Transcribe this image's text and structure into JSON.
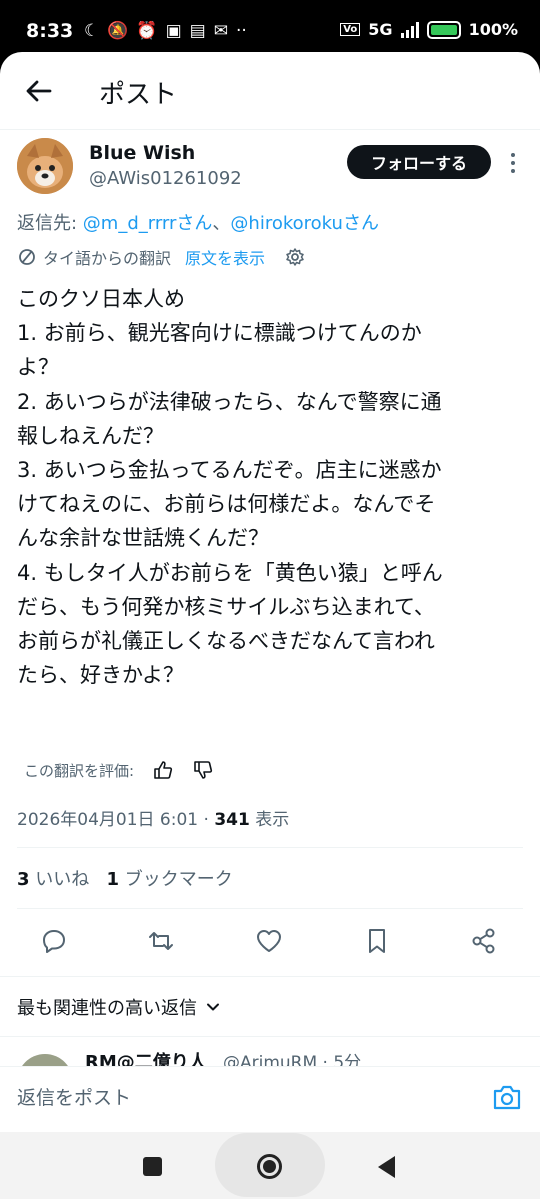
{
  "status_bar": {
    "time": "8:33",
    "network": "5G",
    "battery": "100%"
  },
  "header": {
    "title": "ポスト"
  },
  "post": {
    "author_name": "Blue Wish",
    "author_handle": "@AWis01261092",
    "follow_label": "フォローする",
    "reply_to_prefix": "返信先: ",
    "reply_to_user1": "@m_d_rrrrさん",
    "reply_to_sep": "、",
    "reply_to_user2": "@hirokorokuさん",
    "translated_from": "タイ語からの翻訳",
    "show_original": "原文を表示",
    "text_lines": [
      "このクソ日本人め",
      "1. お前ら、観光客向けに標識つけてんのか",
      "よ？",
      "2. あいつらが法律破ったら、なんで警察に通",
      "報しねえんだ？",
      "3. あいつら金払ってるんだぞ。店主に迷惑か",
      "けてねえのに、お前らは何様だよ。なんでそ",
      "んな余計な世話焼くんだ？",
      "4. もしタイ人がお前らを「黄色い猿」と呼ん",
      "だら、もう何発か核ミサイルぶち込まれて、",
      "お前らが礼儀正しくなるべきだなんて言われ",
      "たら、好きかよ？"
    ],
    "rate_translation": "この翻訳を評価:",
    "timestamp": "2026年04月01日 6:01",
    "views_count": "341",
    "views_label": "表示",
    "likes_count": "3",
    "likes_label": "いいね",
    "bookmarks_count": "1",
    "bookmarks_label": "ブックマーク"
  },
  "replies": {
    "sort_label": "最も関連性の高い返信",
    "next_name": "RM@二億り人",
    "next_handle": "@ArimuRM · 5分"
  },
  "reply_bar": {
    "placeholder": "返信をポスト"
  }
}
